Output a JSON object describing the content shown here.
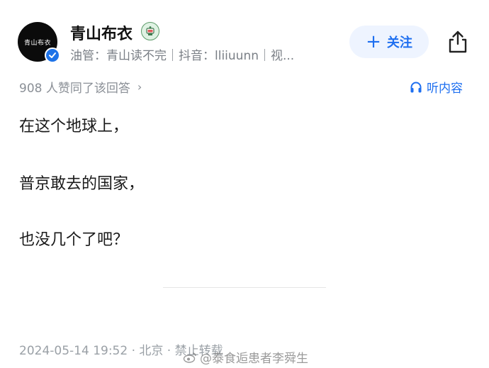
{
  "author": {
    "avatar_text": "青山布衣",
    "name": "青山布衣",
    "bio": "油管：青山读不完｜抖音：lliiuunn｜视..."
  },
  "follow_button": {
    "plus": "+",
    "label": "关注"
  },
  "upvote_text": "908 人赞同了该回答",
  "upvote_chevron": "›",
  "listen_label": "听内容",
  "content": {
    "paragraphs": [
      "在这个地球上，",
      "普京敢去的国家，",
      "也没几个了吧？"
    ]
  },
  "footer": {
    "meta": "2024-05-14 19:52 · 北京 · 禁止转载"
  },
  "watermark": {
    "text": "@泰食逅患者李舜生"
  },
  "colors": {
    "accent": "#1e6ff0",
    "verified": "#1e73e8",
    "muted": "#8a8f96"
  },
  "icons": {
    "verified": "verified-check-icon",
    "badge": "cup-badge-icon",
    "share": "share-icon",
    "listen": "headphones-icon",
    "watermark_logo": "weibo-logo"
  }
}
